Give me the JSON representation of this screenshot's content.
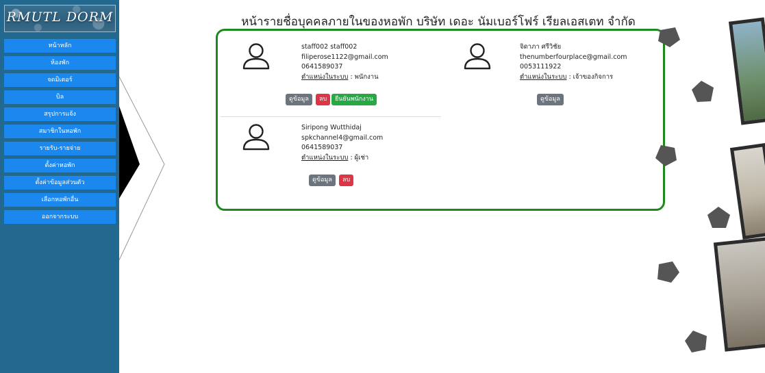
{
  "sidebar": {
    "logo_text": "RMUTL DORM",
    "items": [
      {
        "label": "หน้าหลัก"
      },
      {
        "label": "ห้องพัก"
      },
      {
        "label": "จดมิเตอร์"
      },
      {
        "label": "บิล"
      },
      {
        "label": "สรุปการแจ้ง"
      },
      {
        "label": "สมาชิกในหอพัก"
      },
      {
        "label": "รายรับ-รายจ่าย"
      },
      {
        "label": "ตั้งค่าหอพัก"
      },
      {
        "label": "ตั้งค่าข้อมูลส่วนตัว"
      },
      {
        "label": "เลือกหอพักอื่น"
      },
      {
        "label": "ออกจากระบบ"
      }
    ]
  },
  "page": {
    "title": "หน้ารายชื่อบุคคลภายในของหอพัก บริษัท เดอะ นัมเบอร์โฟร์ เรียลเอสเตท จำกัด"
  },
  "people": [
    {
      "name": "staff002 staff002",
      "email": "filiperose1122@gmail.com",
      "phone": "0641589037",
      "role_label": "ตำแหน่งในระบบ",
      "role_value": " : พนักงาน",
      "buttons": {
        "view": "ดูข้อมูล",
        "delete": "ลบ",
        "confirm": "ยืนยันพนักงาน"
      }
    },
    {
      "name": "จิดาภา ศรีวิชัย",
      "email": "thenumberfourplace@gmail.com",
      "phone": "0053111922",
      "role_label": "ตำแหน่งในระบบ",
      "role_value": " : เจ้าของกิจการ",
      "buttons": {
        "view": "ดูข้อมูล"
      }
    },
    {
      "name": "Siripong Wutthidaj",
      "email": "spkchannel4@gmail.com",
      "phone": "0641589037",
      "role_label": "ตำแหน่งในระบบ",
      "role_value": " : ผู้เช่า",
      "buttons": {
        "view": "ดูข้อมูล",
        "delete": "ลบ"
      }
    }
  ],
  "colors": {
    "sidebar": "#23688f",
    "nav_button": "#1b88f0",
    "panel_border": "#1b8a1b",
    "btn_gray": "#6c757d",
    "btn_red": "#dc3545",
    "btn_green": "#28a745"
  }
}
